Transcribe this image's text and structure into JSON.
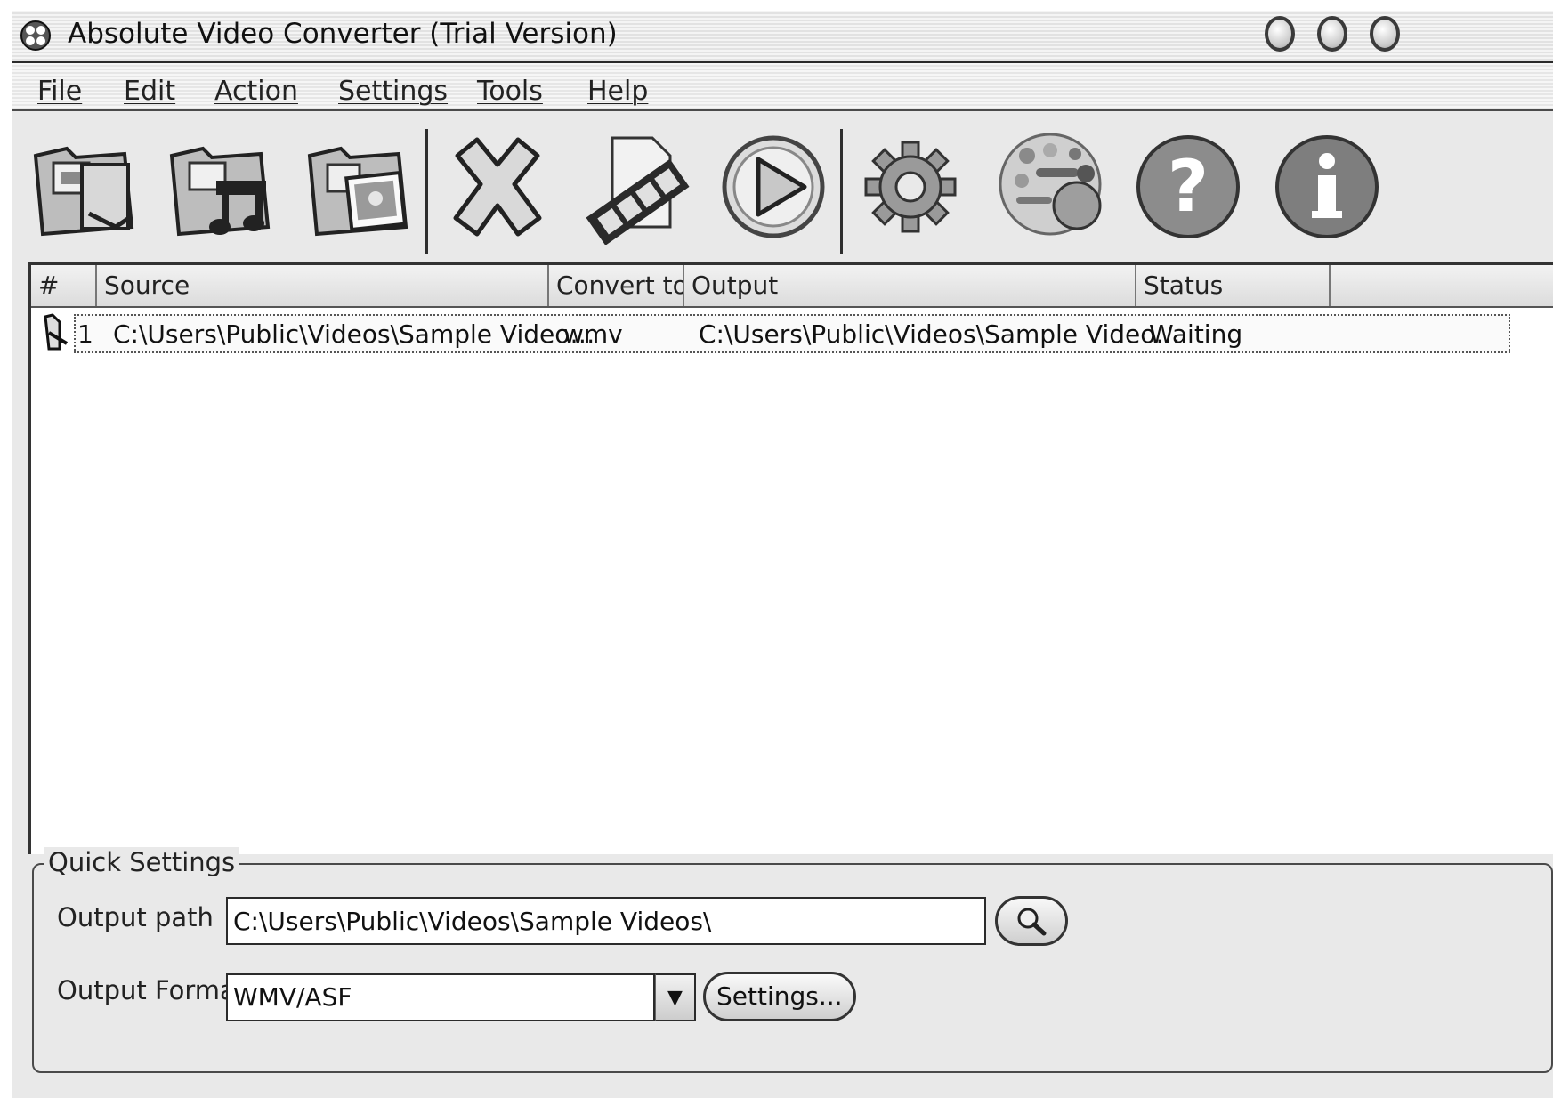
{
  "window": {
    "title": "Absolute Video Converter (Trial Version)"
  },
  "menu": {
    "items": [
      {
        "label": "File"
      },
      {
        "label": "Edit"
      },
      {
        "label": "Action"
      },
      {
        "label": "Settings"
      },
      {
        "label": "Tools"
      },
      {
        "label": "Help"
      }
    ]
  },
  "toolbar": {
    "buttons": [
      {
        "icon": "add-video-folder-icon"
      },
      {
        "icon": "add-audio-folder-icon"
      },
      {
        "icon": "add-image-folder-icon"
      },
      {
        "icon": "remove-icon"
      },
      {
        "icon": "video-file-icon"
      },
      {
        "icon": "play-icon"
      },
      {
        "icon": "settings-gear-icon"
      },
      {
        "icon": "skin-icon"
      },
      {
        "icon": "help-icon"
      },
      {
        "icon": "info-icon"
      }
    ]
  },
  "table": {
    "columns": [
      "#",
      "Source",
      "Convert to",
      "Output",
      "Status"
    ],
    "rows": [
      {
        "num": "1",
        "source": "C:\\Users\\Public\\Videos\\Sample Video…",
        "convert_to": "wmv",
        "output": "C:\\Users\\Public\\Videos\\Sample Video…",
        "status": "Waiting"
      }
    ]
  },
  "quick_settings": {
    "title": "Quick Settings",
    "output_path_label": "Output path",
    "output_path_value": "C:\\Users\\Public\\Videos\\Sample Videos\\",
    "output_format_label": "Output Format",
    "output_format_value": "WMV/ASF",
    "settings_button": "Settings..."
  }
}
